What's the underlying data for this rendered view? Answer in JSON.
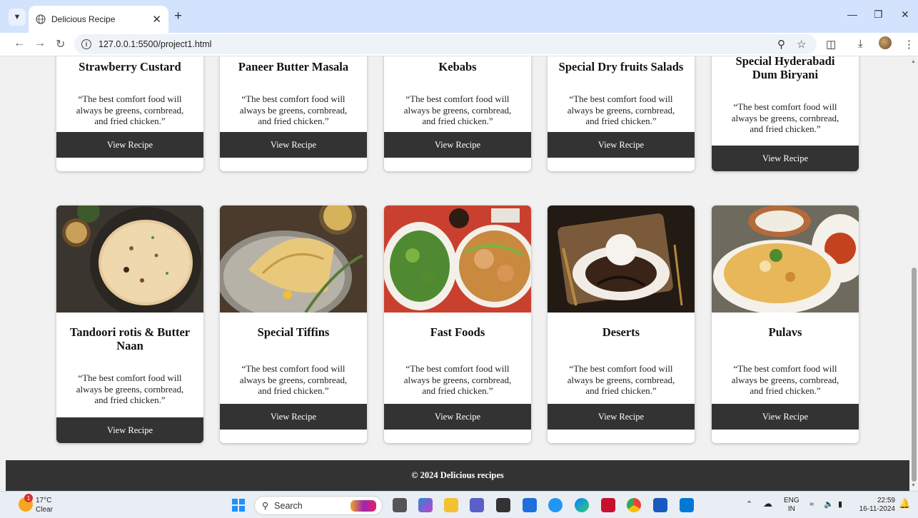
{
  "browser": {
    "tab_title": "Delicious Recipe",
    "url": "127.0.0.1:5500/project1.html"
  },
  "page": {
    "view_label": "View Recipe",
    "quote": "“The best comfort food will always be greens, cornbread, and fried chicken.”",
    "top_row": [
      {
        "title": "Strawberry Custard"
      },
      {
        "title": "Paneer Butter Masala"
      },
      {
        "title": "Kebabs"
      },
      {
        "title": "Special Dry fruits Salads"
      },
      {
        "title": "Special Hyderabadi Dum Biryani"
      }
    ],
    "bottom_row": [
      {
        "title": "Tandoori rotis & Butter Naan"
      },
      {
        "title": "Special Tiffins"
      },
      {
        "title": "Fast Foods"
      },
      {
        "title": "Deserts"
      },
      {
        "title": "Pulavs"
      }
    ],
    "footer": "© 2024 Delicious recipes"
  },
  "taskbar": {
    "weather_temp": "17°C",
    "weather_condition": "Clear",
    "weather_badge": "1",
    "search_placeholder": "Search",
    "language": "ENG",
    "region": "IN",
    "time": "22:59",
    "date": "16-11-2024"
  }
}
